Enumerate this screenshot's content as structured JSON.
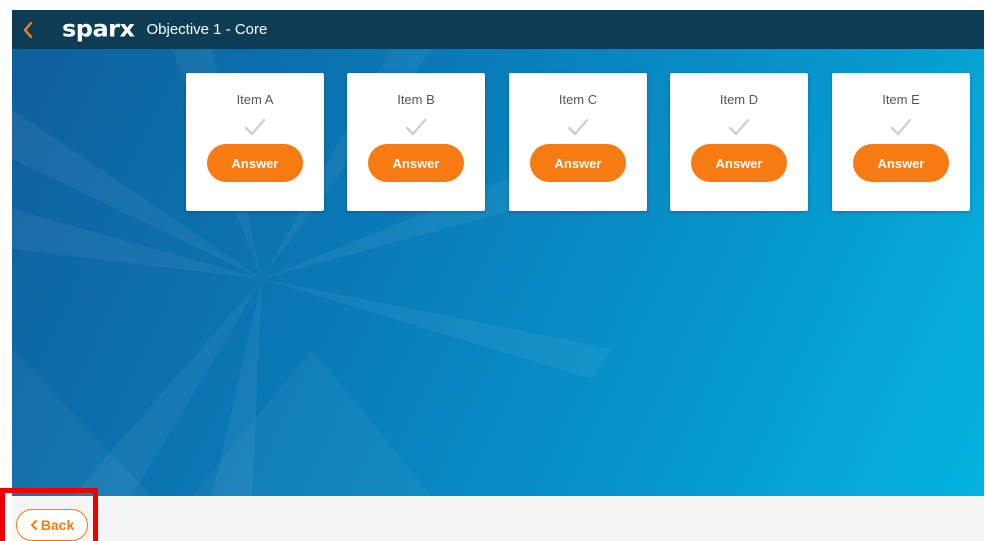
{
  "header": {
    "logo": "sparx",
    "title": "Objective 1 - Core"
  },
  "items": [
    {
      "label": "Item A",
      "button": "Answer"
    },
    {
      "label": "Item B",
      "button": "Answer"
    },
    {
      "label": "Item C",
      "button": "Answer"
    },
    {
      "label": "Item D",
      "button": "Answer"
    },
    {
      "label": "Item E",
      "button": "Answer"
    }
  ],
  "footer": {
    "back_label": "Back"
  },
  "colors": {
    "topbar": "#0c3d55",
    "accent": "#f57b12",
    "highlight": "#ee0000"
  }
}
